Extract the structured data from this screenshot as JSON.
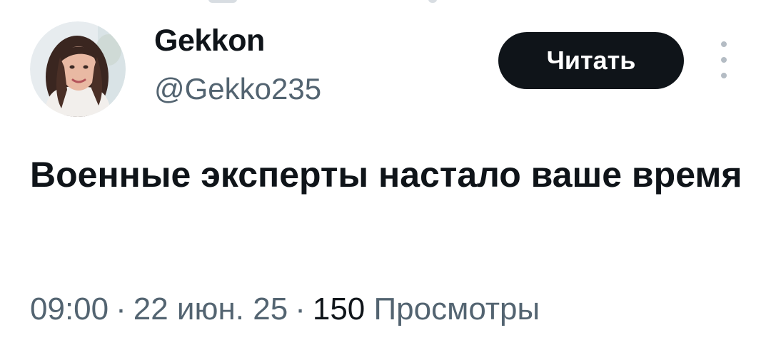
{
  "author": {
    "display_name": "Gekkon",
    "handle": "@Gekko235"
  },
  "actions": {
    "follow_label": "Читать",
    "more_icon": "more-vertical-icon"
  },
  "post": {
    "text": "Военные эксперты настало ваше время"
  },
  "meta": {
    "time": "09:00",
    "date": "22 июн. 25",
    "separator": "·",
    "views_count": "150",
    "views_label": "Просмотры"
  },
  "colors": {
    "text_primary": "#0f1419",
    "text_secondary": "#536471",
    "button_bg": "#0f1419",
    "button_text": "#ffffff",
    "background": "#ffffff"
  }
}
